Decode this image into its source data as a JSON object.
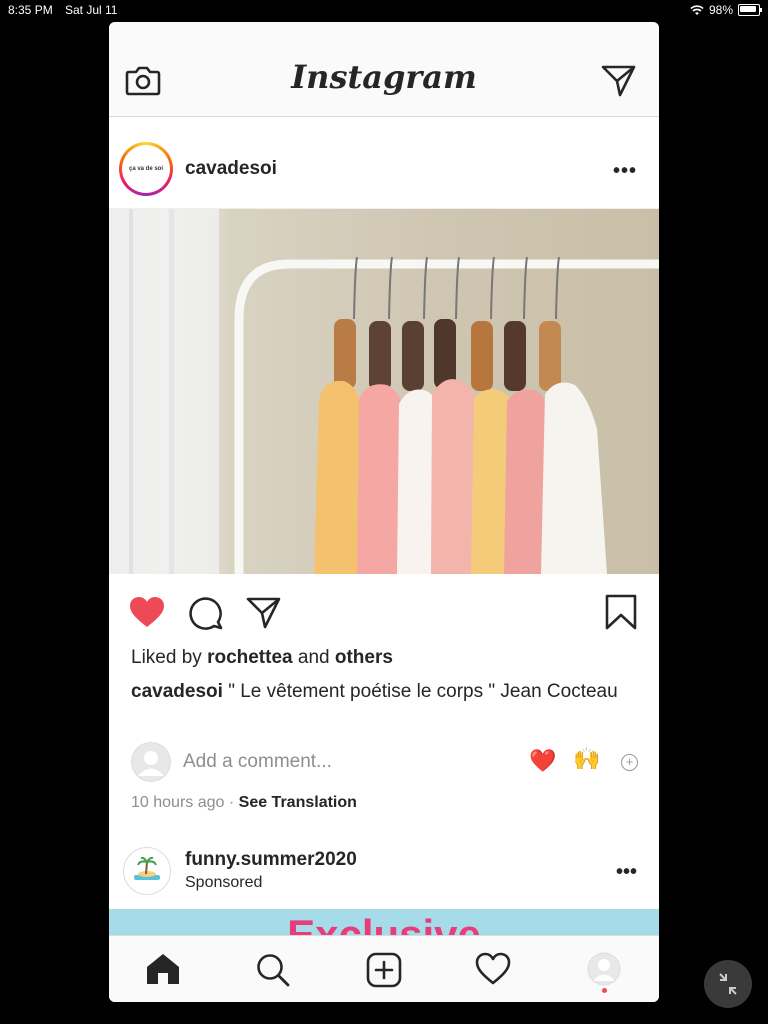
{
  "status_bar": {
    "time": "8:35 PM",
    "date": "Sat Jul 11",
    "battery": "98%"
  },
  "header": {
    "logo": "Instagram",
    "left_icon": "camera-icon",
    "right_icon": "direct-send-icon"
  },
  "post": {
    "username": "cavadesoi",
    "avatar_text": "ça va de soi",
    "liked_by_prefix": "Liked by",
    "liked_by_user": "rochettea",
    "liked_by_and": "and",
    "liked_by_others": "others",
    "caption_user": "cavadesoi",
    "caption_text": "\" Le vêtement poétise le corps \" Jean Cocteau",
    "comment_placeholder": "Add a comment...",
    "quick_emoji_1": "❤️",
    "quick_emoji_2": "🙌",
    "time_ago": "10 hours ago",
    "separator": "·",
    "see_translation": "See Translation",
    "liked": true
  },
  "sponsored_post": {
    "username": "funny.summer2020",
    "label": "Sponsored",
    "banner_text": "Exclusive"
  },
  "tabbar": [
    "home-icon",
    "search-icon",
    "new-post-icon",
    "activity-icon",
    "profile-icon"
  ],
  "colors": {
    "like": "#ed4956",
    "text": "#262626",
    "muted": "#8e8e8e",
    "banner": "#a6dcea",
    "banner_text": "#e83d7a"
  }
}
